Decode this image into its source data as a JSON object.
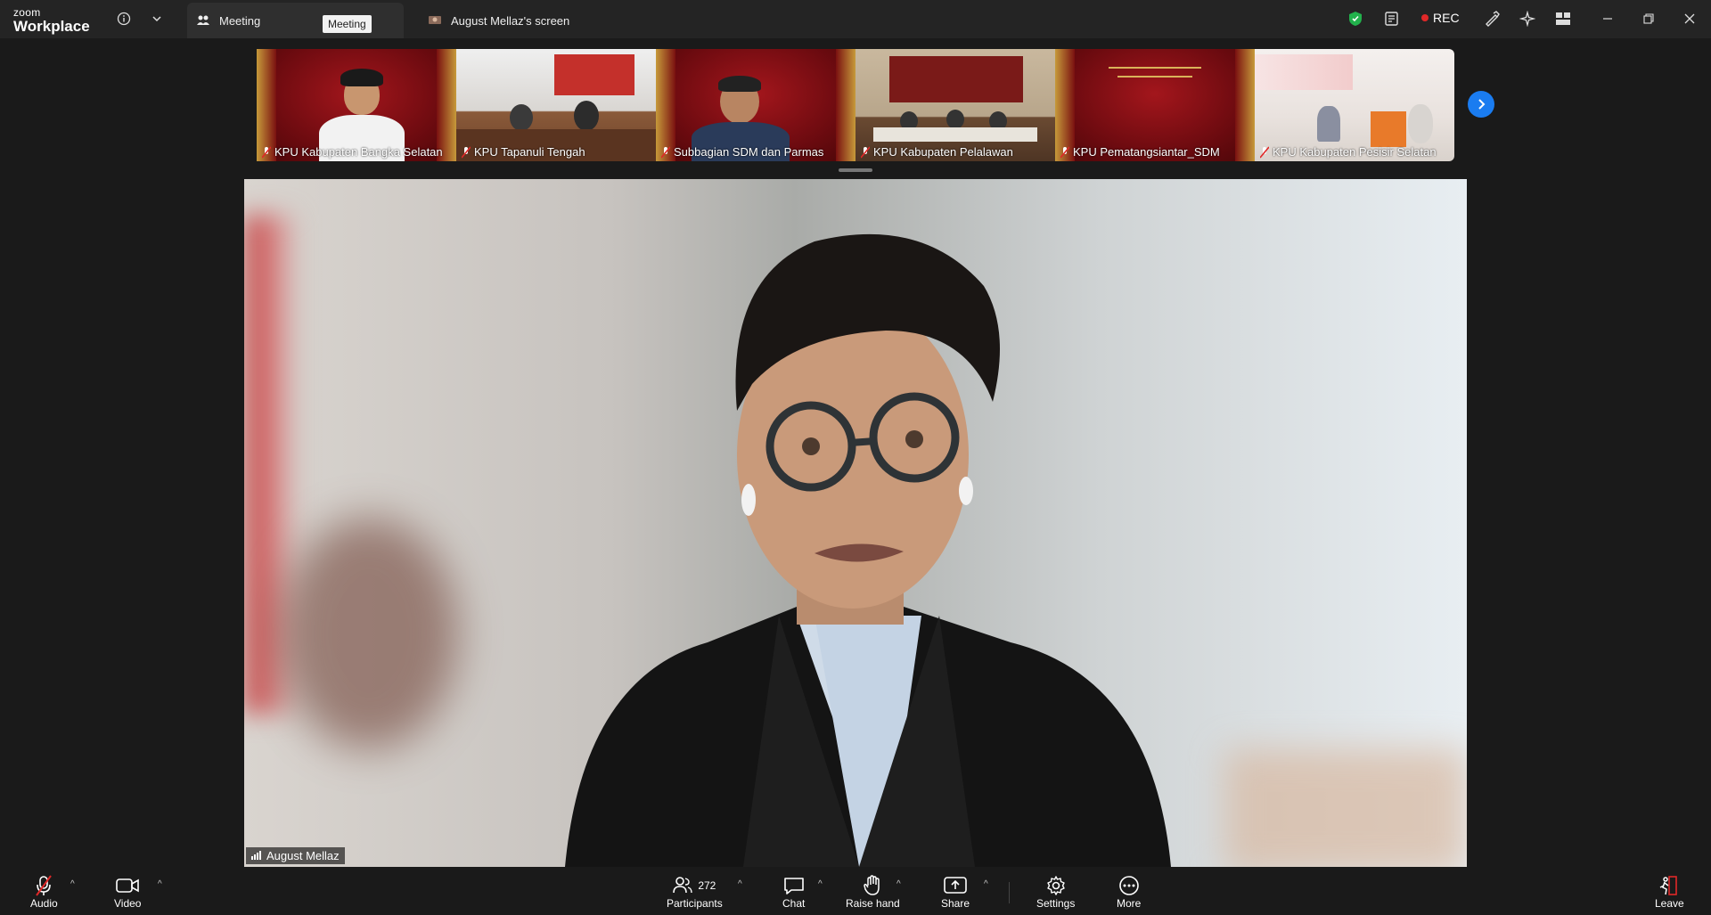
{
  "titlebar": {
    "brand_small": "zoom",
    "brand_big": "Workplace",
    "tabs": [
      {
        "label": "Meeting",
        "icon": "participants-icon",
        "active": true
      },
      {
        "label": "August Mellaz's screen",
        "icon": "screen-share-icon",
        "active": false
      }
    ],
    "meeting_badge": "Meeting",
    "rec_label": "REC",
    "colors": {
      "shield": "#22b14c",
      "rec": "#e02828"
    }
  },
  "thumbnails": [
    {
      "label": "KPU Kabupaten Bangka Selatan"
    },
    {
      "label": "KPU Tapanuli Tengah"
    },
    {
      "label": "Subbagian SDM dan Parmas"
    },
    {
      "label": "KPU Kabupaten Pelalawan"
    },
    {
      "label": "KPU Pematangsiantar_SDM"
    },
    {
      "label": "KPU Kabupaten Pesisir Selatan"
    }
  ],
  "main_video": {
    "speaker_name": "August Mellaz"
  },
  "toolbar": {
    "audio": "Audio",
    "video": "Video",
    "participants": "Participants",
    "participants_count": "272",
    "chat": "Chat",
    "raise_hand": "Raise hand",
    "share": "Share",
    "settings": "Settings",
    "more": "More",
    "leave": "Leave",
    "accent": "#1a7cf0",
    "share_color": "#22b14c",
    "leave_color": "#e02828"
  }
}
